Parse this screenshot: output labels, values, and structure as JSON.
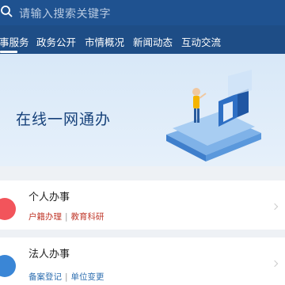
{
  "search": {
    "placeholder": "请输入搜索关键字"
  },
  "tabs": [
    {
      "label": "事服务",
      "active": true
    },
    {
      "label": "政务公开"
    },
    {
      "label": "市情概况"
    },
    {
      "label": "新闻动态"
    },
    {
      "label": "互动交流"
    }
  ],
  "banner": {
    "title": "在线一网通办"
  },
  "cards": [
    {
      "title": "个人办事",
      "tags": [
        "户籍办理",
        "教育科研"
      ]
    },
    {
      "title": "法人办事",
      "tags": [
        "备案登记",
        "单位变更"
      ]
    }
  ],
  "colors": {
    "header": "#1e4d86",
    "personal_accent": "#f2545b",
    "legal_accent": "#3a86d6"
  }
}
